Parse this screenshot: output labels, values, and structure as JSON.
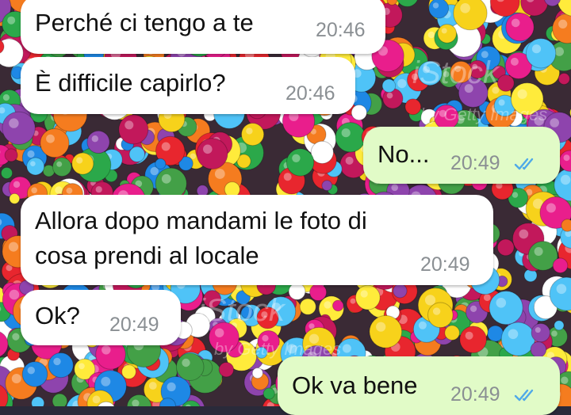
{
  "messages": [
    {
      "text": "Perché ci tengo a te",
      "time": "20:46",
      "direction": "in"
    },
    {
      "text": "È difficile capirlo?",
      "time": "20:46",
      "direction": "in"
    },
    {
      "text": "No...",
      "time": "20:49",
      "direction": "out",
      "status": "read-double-check-icon"
    },
    {
      "text_line1": "Allora dopo mandami le foto di",
      "text_line2": "cosa prendi al locale",
      "time": "20:49",
      "direction": "in"
    },
    {
      "text": "Ok?",
      "time": "20:49",
      "direction": "in"
    },
    {
      "text": "Ok va bene",
      "time": "20:49",
      "direction": "out",
      "status": "read-double-check-icon"
    }
  ],
  "wallpaper": {
    "watermark1": "iStock",
    "watermark2": "by Getty Images",
    "watermark3": "iStock",
    "watermark4": "by Getty Images"
  },
  "colors": {
    "incoming": "#ffffff",
    "outgoing": "#e1fbc7",
    "tick_read": "#4fa9e8",
    "time_text": "#8a8f93"
  }
}
